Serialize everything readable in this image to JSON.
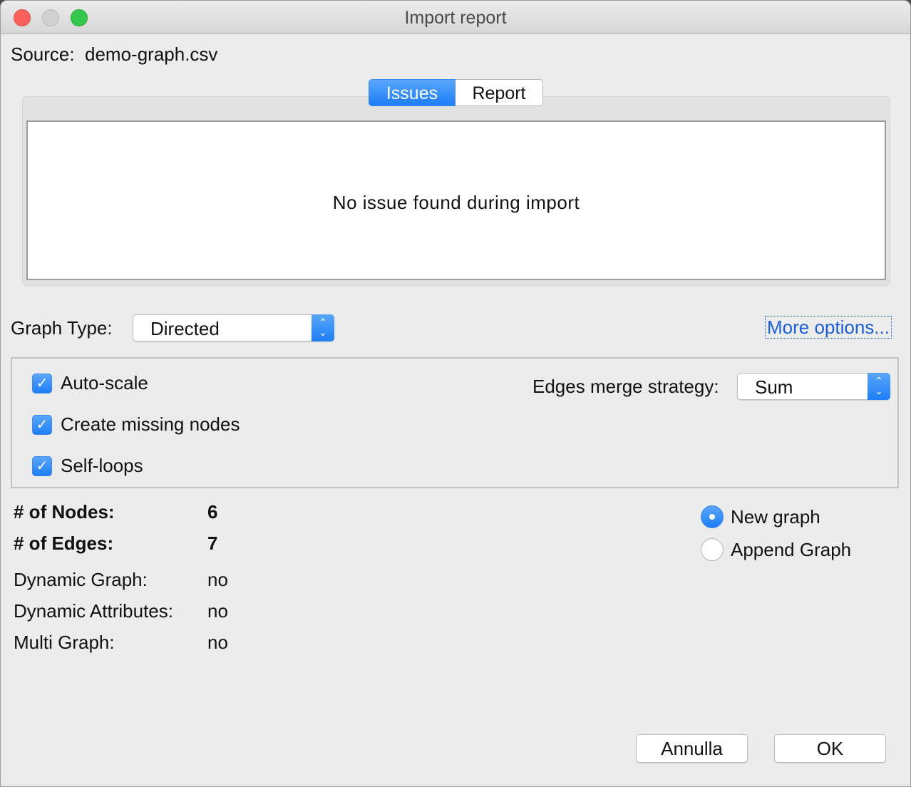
{
  "window": {
    "title": "Import report"
  },
  "source": {
    "label": "Source:",
    "value": "demo-graph.csv"
  },
  "tabs": [
    {
      "label": "Issues",
      "active": true
    },
    {
      "label": "Report",
      "active": false
    }
  ],
  "issues": {
    "message": "No issue found during import"
  },
  "graph_type": {
    "label": "Graph Type:",
    "value": "Directed"
  },
  "more_options": {
    "label": "More options..."
  },
  "options": {
    "checkboxes": [
      {
        "label": "Auto-scale",
        "checked": true
      },
      {
        "label": "Create missing nodes",
        "checked": true
      },
      {
        "label": "Self-loops",
        "checked": true
      }
    ],
    "merge_strategy": {
      "label": "Edges merge strategy:",
      "value": "Sum"
    }
  },
  "stats": {
    "nodes": {
      "label": "# of Nodes:",
      "value": "6"
    },
    "edges": {
      "label": "# of Edges:",
      "value": "7"
    },
    "dynamic_graph": {
      "label": "Dynamic Graph:",
      "value": "no"
    },
    "dynamic_attributes": {
      "label": "Dynamic Attributes:",
      "value": "no"
    },
    "multi_graph": {
      "label": "Multi Graph:",
      "value": "no"
    }
  },
  "mode": {
    "options": [
      {
        "label": "New graph",
        "selected": true
      },
      {
        "label": "Append Graph",
        "selected": false
      }
    ]
  },
  "buttons": {
    "cancel": "Annulla",
    "ok": "OK"
  },
  "colors": {
    "accent": "#1d7ef6",
    "link": "#1a5fd6"
  }
}
